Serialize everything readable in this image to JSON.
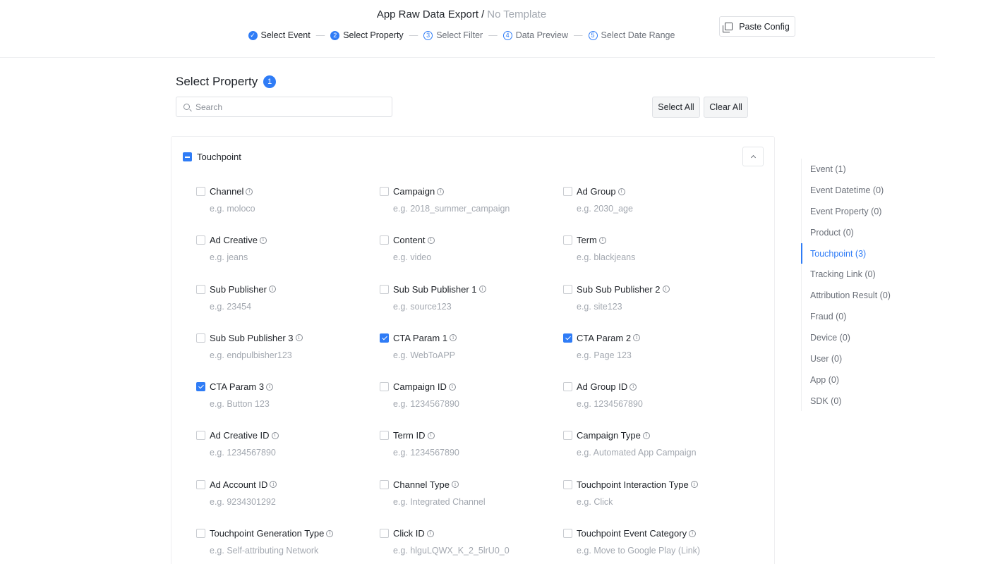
{
  "header": {
    "title": "App Raw Data Export",
    "separator": "/",
    "template": "No Template",
    "paste_config_label": "Paste Config"
  },
  "steps": [
    {
      "num": "✓",
      "label": "Select Event",
      "state": "done"
    },
    {
      "num": "2",
      "label": "Select Property",
      "state": "active"
    },
    {
      "num": "3",
      "label": "Select Filter",
      "state": "pending"
    },
    {
      "num": "4",
      "label": "Data Preview",
      "state": "pending"
    },
    {
      "num": "5",
      "label": "Select Date Range",
      "state": "pending"
    }
  ],
  "section": {
    "title": "Select Property",
    "count": "1",
    "search_placeholder": "Search",
    "select_all_label": "Select All",
    "clear_all_label": "Clear All"
  },
  "group": {
    "title": "Touchpoint",
    "items": [
      {
        "label": "Channel",
        "example": "e.g. moloco",
        "checked": false
      },
      {
        "label": "Campaign",
        "example": "e.g. 2018_summer_campaign",
        "checked": false
      },
      {
        "label": "Ad Group",
        "example": "e.g. 2030_age",
        "checked": false
      },
      {
        "label": "Ad Creative",
        "example": "e.g. jeans",
        "checked": false
      },
      {
        "label": "Content",
        "example": "e.g. video",
        "checked": false
      },
      {
        "label": "Term",
        "example": "e.g. blackjeans",
        "checked": false
      },
      {
        "label": "Sub Publisher",
        "example": "e.g. 23454",
        "checked": false
      },
      {
        "label": "Sub Sub Publisher 1",
        "example": "e.g. source123",
        "checked": false
      },
      {
        "label": "Sub Sub Publisher 2",
        "example": "e.g. site123",
        "checked": false
      },
      {
        "label": "Sub Sub Publisher 3",
        "example": "e.g. endpulbisher123",
        "checked": false
      },
      {
        "label": "CTA Param 1",
        "example": "e.g. WebToAPP",
        "checked": true
      },
      {
        "label": "CTA Param 2",
        "example": "e.g. Page 123",
        "checked": true
      },
      {
        "label": "CTA Param 3",
        "example": "e.g. Button 123",
        "checked": true
      },
      {
        "label": "Campaign ID",
        "example": "e.g. 1234567890",
        "checked": false
      },
      {
        "label": "Ad Group ID",
        "example": "e.g. 1234567890",
        "checked": false
      },
      {
        "label": "Ad Creative ID",
        "example": "e.g. 1234567890",
        "checked": false
      },
      {
        "label": "Term ID",
        "example": "e.g. 1234567890",
        "checked": false
      },
      {
        "label": "Campaign Type",
        "example": "e.g. Automated App Campaign",
        "checked": false
      },
      {
        "label": "Ad Account ID",
        "example": "e.g. 9234301292",
        "checked": false
      },
      {
        "label": "Channel Type",
        "example": "e.g. Integrated Channel",
        "checked": false
      },
      {
        "label": "Touchpoint Interaction Type",
        "example": "e.g. Click",
        "checked": false
      },
      {
        "label": "Touchpoint Generation Type",
        "example": "e.g. Self-attributing Network",
        "checked": false
      },
      {
        "label": "Click ID",
        "example": "e.g. hlguLQWX_K_2_5lrU0_0",
        "checked": false
      },
      {
        "label": "Touchpoint Event Category",
        "example": "e.g. Move to Google Play (Link)",
        "checked": false
      }
    ]
  },
  "nav": [
    {
      "label": "Event (1)",
      "active": false
    },
    {
      "label": "Event Datetime (0)",
      "active": false
    },
    {
      "label": "Event Property (0)",
      "active": false
    },
    {
      "label": "Product (0)",
      "active": false
    },
    {
      "label": "Touchpoint (3)",
      "active": true
    },
    {
      "label": "Tracking Link (0)",
      "active": false
    },
    {
      "label": "Attribution Result (0)",
      "active": false
    },
    {
      "label": "Fraud (0)",
      "active": false
    },
    {
      "label": "Device (0)",
      "active": false
    },
    {
      "label": "User (0)",
      "active": false
    },
    {
      "label": "App (0)",
      "active": false
    },
    {
      "label": "SDK (0)",
      "active": false
    }
  ],
  "colors": {
    "accent": "#2f7cf6",
    "muted": "#a3a8b0"
  }
}
